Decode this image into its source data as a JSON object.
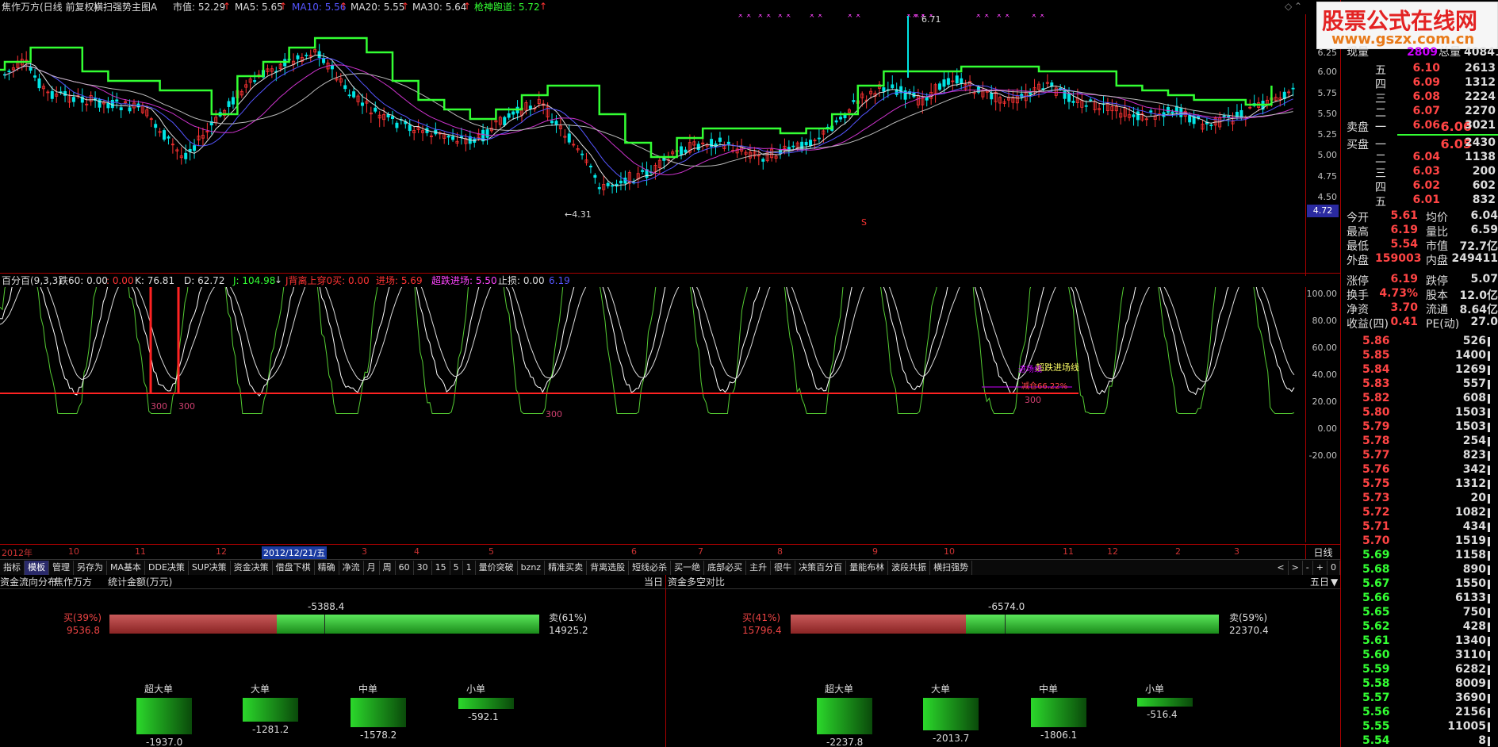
{
  "header": {
    "title": "焦作万方(日线 前复权)",
    "template": "横扫强势主图A",
    "shizhi": "市值: 52.29",
    "ma5": "MA5: 5.65",
    "ma10": "MA10: 5.56",
    "ma20": "MA20: 5.55",
    "ma30": "MA30: 5.64",
    "qiang": "枪神跑道: 5.72"
  },
  "main_ticks": [
    "6.25",
    "6.00",
    "5.75",
    "5.50",
    "5.25",
    "5.00",
    "4.75",
    "4.50"
  ],
  "main_annotations": {
    "high": "6.71",
    "low": "4.31",
    "price_box": "4.72",
    "s_marker": "S"
  },
  "osc_header": {
    "name": "百分百(9,3,3)",
    "die60": "跌60: 0.00",
    "v2": ": 0.00",
    "k": "K: 76.81",
    "d": "D: 62.72",
    "j": "J: 104.98",
    "jb": "J背离上穿0买: 0.00",
    "jinchang": "进场: 5.69",
    "chaodie": "超跌进场: 5.50",
    "zhisun": "止损: 0.00",
    "last": "6.19"
  },
  "osc_ticks": [
    "100.00",
    "80.00",
    "60.00",
    "40.00",
    "20.00",
    "0.00",
    "-20.00"
  ],
  "osc_labels": {
    "a": "300",
    "b": "300",
    "c": "300",
    "d": "300",
    "jin": "超跌进场线",
    "jin2": "进场线",
    "jian": "减仓66.22%"
  },
  "timeline": {
    "items": [
      "2012年",
      "10",
      "11",
      "12",
      "2012/12/21/五",
      "3",
      "4",
      "5",
      "6",
      "7",
      "8",
      "9",
      "10",
      "11",
      "12",
      "2",
      "3"
    ],
    "right": "日线"
  },
  "tabs": [
    "指标",
    "模板",
    "管理",
    "另存为",
    "MA基本",
    "DDE决策",
    "SUP决策",
    "资金决策",
    "借盘下棋",
    "精确",
    "净流",
    "月",
    "周",
    "60",
    "30",
    "15",
    "5",
    "1",
    "量价突破",
    "bznz",
    "精准买卖",
    "背离选股",
    "短线必杀",
    "买一绝",
    "底部必买",
    "主升",
    "很牛",
    "决策百分百",
    "量能布林",
    "波段共振",
    "横扫强势"
  ],
  "tab_controls": [
    "<",
    ">",
    "-",
    "+",
    "0"
  ],
  "panel_left": {
    "title": "资金流向分布",
    "company": "焦作万方",
    "unit": "统计金额(万元)",
    "period": "当日",
    "net": "-5388.4",
    "buy_label": "买(39%)",
    "buy_value": "9536.8",
    "sell_label": "卖(61%)",
    "sell_value": "14925.2",
    "buy_pct": 39,
    "bars": [
      {
        "label": "超大单",
        "value": "-1937.0",
        "mag": 1937
      },
      {
        "label": "大单",
        "value": "-1281.2",
        "mag": 1281.2
      },
      {
        "label": "中单",
        "value": "-1578.2",
        "mag": 1578.2
      },
      {
        "label": "小单",
        "value": "-592.1",
        "mag": 592.1
      }
    ]
  },
  "panel_right": {
    "title": "资金多空对比",
    "period": "五日",
    "net": "-6574.0",
    "buy_label": "买(41%)",
    "buy_value": "15796.4",
    "sell_label": "卖(59%)",
    "sell_value": "22370.4",
    "buy_pct": 41,
    "bars": [
      {
        "label": "超大单",
        "value": "-2237.8",
        "mag": 2237.8
      },
      {
        "label": "大单",
        "value": "-2013.7",
        "mag": 2013.7
      },
      {
        "label": "中单",
        "value": "-1806.1",
        "mag": 1806.1
      },
      {
        "label": "小单",
        "value": "-516.4",
        "mag": 516.4
      }
    ]
  },
  "watermark": {
    "line1": "股票公式在线网",
    "line2": "www.gszx.com.cn"
  },
  "quote": {
    "xianliang_label": "现量",
    "xianliang": "2809",
    "zongliang_label": "总量",
    "zongliang": "40841",
    "sell": [
      {
        "lvl": "五",
        "price": "6.10",
        "vol": "2613"
      },
      {
        "lvl": "四",
        "price": "6.09",
        "vol": "1312"
      },
      {
        "lvl": "三",
        "price": "6.08",
        "vol": "2224"
      },
      {
        "lvl": "二",
        "price": "6.07",
        "vol": "2270"
      },
      {
        "lvl": "一",
        "price": "6.06",
        "vol": "3021"
      }
    ],
    "buy": [
      {
        "lvl": "一",
        "price": "6.05",
        "vol": "2430"
      },
      {
        "lvl": "二",
        "price": "6.04",
        "vol": "1138"
      },
      {
        "lvl": "三",
        "price": "6.03",
        "vol": "200"
      },
      {
        "lvl": "四",
        "price": "6.02",
        "vol": "602"
      },
      {
        "lvl": "五",
        "price": "6.01",
        "vol": "832"
      }
    ],
    "sell_side": "卖盘",
    "buy_side": "买盘",
    "stats": [
      {
        "l1": "今开",
        "v1": "5.61",
        "l2": "均价",
        "v2": "6.04"
      },
      {
        "l1": "最高",
        "v1": "6.19",
        "l2": "量比",
        "v2": "6.59"
      },
      {
        "l1": "最低",
        "v1": "5.54",
        "l2": "市值",
        "v2": "72.7亿"
      },
      {
        "l1": "外盘",
        "v1": "159003",
        "l2": "内盘",
        "v2": "249411"
      }
    ],
    "stats2": [
      {
        "l1": "涨停",
        "v1": "6.19",
        "l2": "跌停",
        "v2": "5.07"
      },
      {
        "l1": "换手",
        "v1": "4.73%",
        "l2": "股本",
        "v2": "12.0亿"
      },
      {
        "l1": "净资",
        "v1": "3.70",
        "l2": "流通",
        "v2": "8.64亿"
      },
      {
        "l1": "收益(四)",
        "v1": "0.41",
        "l2": "PE(动)",
        "v2": "27.0"
      }
    ],
    "book": [
      {
        "p": "5.86",
        "v": "526"
      },
      {
        "p": "5.85",
        "v": "1400"
      },
      {
        "p": "5.84",
        "v": "1269"
      },
      {
        "p": "5.83",
        "v": "557"
      },
      {
        "p": "5.82",
        "v": "608"
      },
      {
        "p": "5.80",
        "v": "1503"
      },
      {
        "p": "5.79",
        "v": "1503"
      },
      {
        "p": "5.78",
        "v": "254"
      },
      {
        "p": "5.77",
        "v": "823"
      },
      {
        "p": "5.76",
        "v": "342"
      },
      {
        "p": "5.75",
        "v": "1312"
      },
      {
        "p": "5.73",
        "v": "20"
      },
      {
        "p": "5.72",
        "v": "1082"
      },
      {
        "p": "5.71",
        "v": "434"
      },
      {
        "p": "5.70",
        "v": "1519"
      },
      {
        "p": "5.69",
        "v": "1158"
      },
      {
        "p": "5.68",
        "v": "890"
      },
      {
        "p": "5.67",
        "v": "1550"
      },
      {
        "p": "5.66",
        "v": "6133"
      },
      {
        "p": "5.65",
        "v": "750"
      },
      {
        "p": "5.62",
        "v": "428"
      },
      {
        "p": "5.61",
        "v": "1340"
      },
      {
        "p": "5.60",
        "v": "3110"
      },
      {
        "p": "5.59",
        "v": "6282"
      },
      {
        "p": "5.58",
        "v": "8009"
      },
      {
        "p": "5.57",
        "v": "3690"
      },
      {
        "p": "5.56",
        "v": "2156"
      },
      {
        "p": "5.55",
        "v": "11005"
      },
      {
        "p": "5.54",
        "v": "8"
      }
    ]
  },
  "colors": {
    "up": "#ff3333",
    "down": "#00e5e5",
    "green": "#33ff33",
    "ma10": "#5555ff",
    "magenta": "#ff44ff"
  }
}
